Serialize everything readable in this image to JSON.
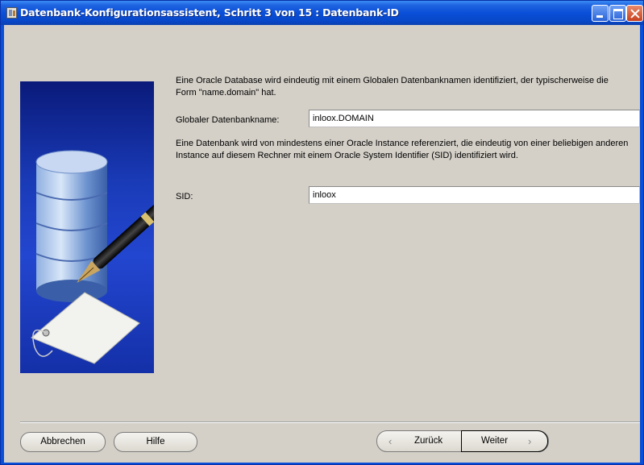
{
  "window": {
    "title": "Datenbank-Konfigurationsassistent, Schritt 3 von 15 : Datenbank-ID"
  },
  "content": {
    "intro_text": "Eine Oracle Database wird eindeutig mit einem Globalen Datenbanknamen identifiziert, der typischerweise die Form \"name.domain\" hat.",
    "global_db_name": {
      "label": "Globaler Datenbankname:",
      "value": "inloox.DOMAIN"
    },
    "sid_text": "Eine Datenbank wird von mindestens einer Oracle Instance referenziert, die eindeutig von einer beliebigen anderen Instance auf diesem Rechner mit einem Oracle System Identifier (SID) identifiziert wird.",
    "sid": {
      "label": "SID:",
      "value": "inloox"
    }
  },
  "buttons": {
    "cancel": "Abbrechen",
    "help": "Hilfe",
    "back": "Zurück",
    "next": "Weiter"
  },
  "colors": {
    "titlebar": "#0a4fd8",
    "dialog_bg": "#d4d0c8",
    "side_image_bg": "#1a3bb8"
  },
  "icons": [
    "app-icon",
    "minimize-icon",
    "maximize-icon",
    "close-icon",
    "database-illustration-icon",
    "chevron-left-icon",
    "chevron-right-icon"
  ]
}
